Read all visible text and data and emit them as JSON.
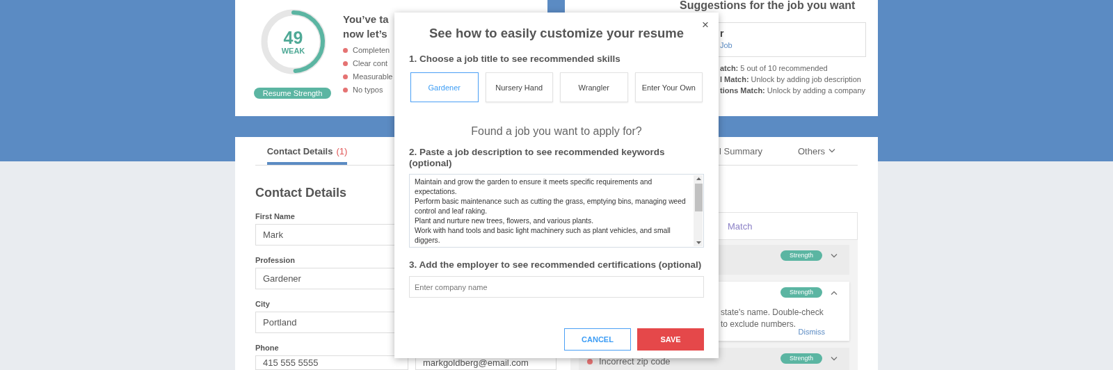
{
  "score_card": {
    "score": "49",
    "rating": "WEAK",
    "gauge": {
      "level": 0.49
    },
    "badge": "Resume Strength",
    "heading_lines": [
      "You’ve ta",
      "now let’s"
    ],
    "checklist": [
      "Completen",
      "Clear cont",
      "Measurable",
      "No typos"
    ]
  },
  "suggestions_card": {
    "title": "Suggestions for the job you want",
    "job_box": {
      "title": "r",
      "link": "Job"
    },
    "matches": [
      "**atch:** 5 out of 10 recommended",
      "**l Match:** Unlock by adding job description",
      "**tions Match:** Unlock by adding a company"
    ]
  },
  "tabs": [
    {
      "label": "Contact Details",
      "count": "(1)",
      "selected": true,
      "dropdown": false
    },
    {
      "label": "l Summary",
      "selected": false,
      "dropdown": false
    },
    {
      "label": "Others",
      "selected": false,
      "dropdown": true
    }
  ],
  "contact_form": {
    "title": "Contact Details",
    "fields": [
      {
        "label": "First Name",
        "value": "Mark"
      },
      {
        "label": "Profession",
        "value": "Gardener"
      },
      {
        "label": "City",
        "value": "Portland"
      },
      {
        "label": "Phone",
        "value": "415 555 5555"
      }
    ],
    "email_value": "markgoldberg@email.com"
  },
  "checks_panel": {
    "header": "Match",
    "items": [
      {
        "badge": "Strength",
        "expanded": false
      },
      {
        "badge": "Strength",
        "expanded": true,
        "text_lines": [
          "state's name. Double-check",
          "to exclude numbers."
        ],
        "action": "Dismiss"
      },
      {
        "badge": "Strength",
        "expanded": false,
        "title": "Incorrect zip code"
      }
    ]
  },
  "modal": {
    "title": "See how to easily customize your resume",
    "close": "×",
    "step1": "1. Choose a job title to see recommended skills",
    "job_titles": [
      {
        "label": "Gardener",
        "selected": true
      },
      {
        "label": "Nursery Hand",
        "selected": false
      },
      {
        "label": "Wrangler",
        "selected": false
      },
      {
        "label": "Enter Your Own",
        "selected": false
      }
    ],
    "prompt": "Found a job you want to apply for?",
    "step2": "2. Paste a job description to see recommended keywords (optional)",
    "description_lines": [
      "Maintain and grow the garden to ensure it meets specific requirements and expectations.",
      "Perform basic maintenance such as cutting the grass, emptying bins, managing weed control and leaf raking.",
      "Plant and nurture new trees, flowers, and various plants.",
      "Work with hand tools and basic light machinery such as plant vehicles, and small diggers."
    ],
    "step3": "3. Add the employer to see recommended certifications (optional)",
    "company_field": {
      "placeholder": "Enter company name"
    },
    "buttons": [
      {
        "label": "CANCEL",
        "kind": "secondary"
      },
      {
        "label": "SAVE",
        "kind": "primary"
      }
    ]
  }
}
